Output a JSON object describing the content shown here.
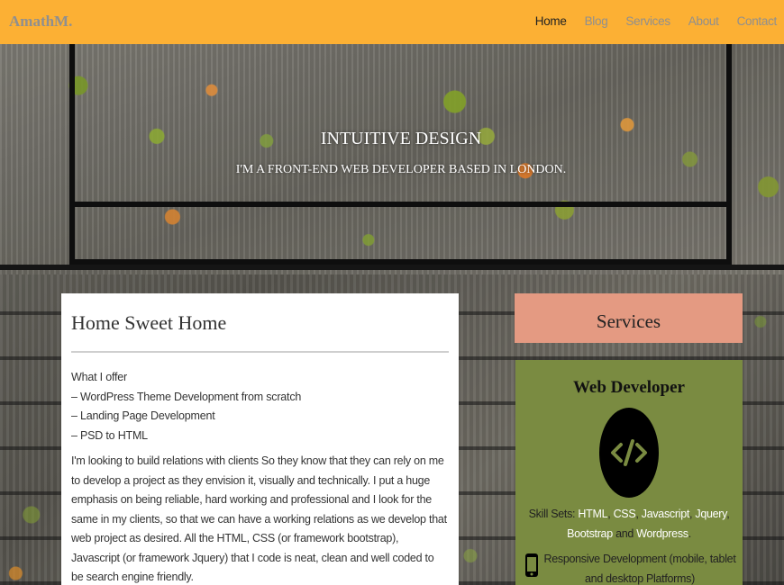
{
  "navbar": {
    "brand": "AmathM.",
    "links": [
      "Home",
      "Blog",
      "Services",
      "About",
      "Contact"
    ],
    "active": "Home"
  },
  "hero": {
    "title": "INTUITIVE DESIGN",
    "subtitle": "I'M A FRONT-END WEB DEVELOPER BASED IN LONDON."
  },
  "main": {
    "title": "Home Sweet Home",
    "offer_heading": "What I offer",
    "offers": [
      "– WordPress Theme Development from scratch",
      "– Landing Page Development",
      "– PSD to HTML"
    ],
    "paragraph": "I'm looking to build relations with clients So they know that they can rely on me to develop a project as they envision it, visually and technically. I put a huge emphasis on being reliable, hard working and professional and I look for the same in my clients, so that we can have a working relations as we develop that web project as desired. All the HTML, CSS (or framework bootstrap), Javascript (or framework Jquery) that I code is neat, clean and well coded to be search engine friendly."
  },
  "sidebar": {
    "heading": "Services",
    "card_title": "Web Developer",
    "card_icon": "code-icon",
    "skills_label": "Skill Sets:",
    "skills": [
      "HTML",
      "CSS",
      "Javascript",
      "Jquery",
      "Bootstrap",
      "Wordpress"
    ],
    "skills_and": "and",
    "responsive_icon": "mobile-phone-icon",
    "responsive_text": "Responsive Development (mobile, tablet and desktop Platforms)"
  },
  "colors": {
    "navbar": "#fcb034",
    "services_heading": "#e49a82",
    "services_card": "#7a8b41"
  }
}
